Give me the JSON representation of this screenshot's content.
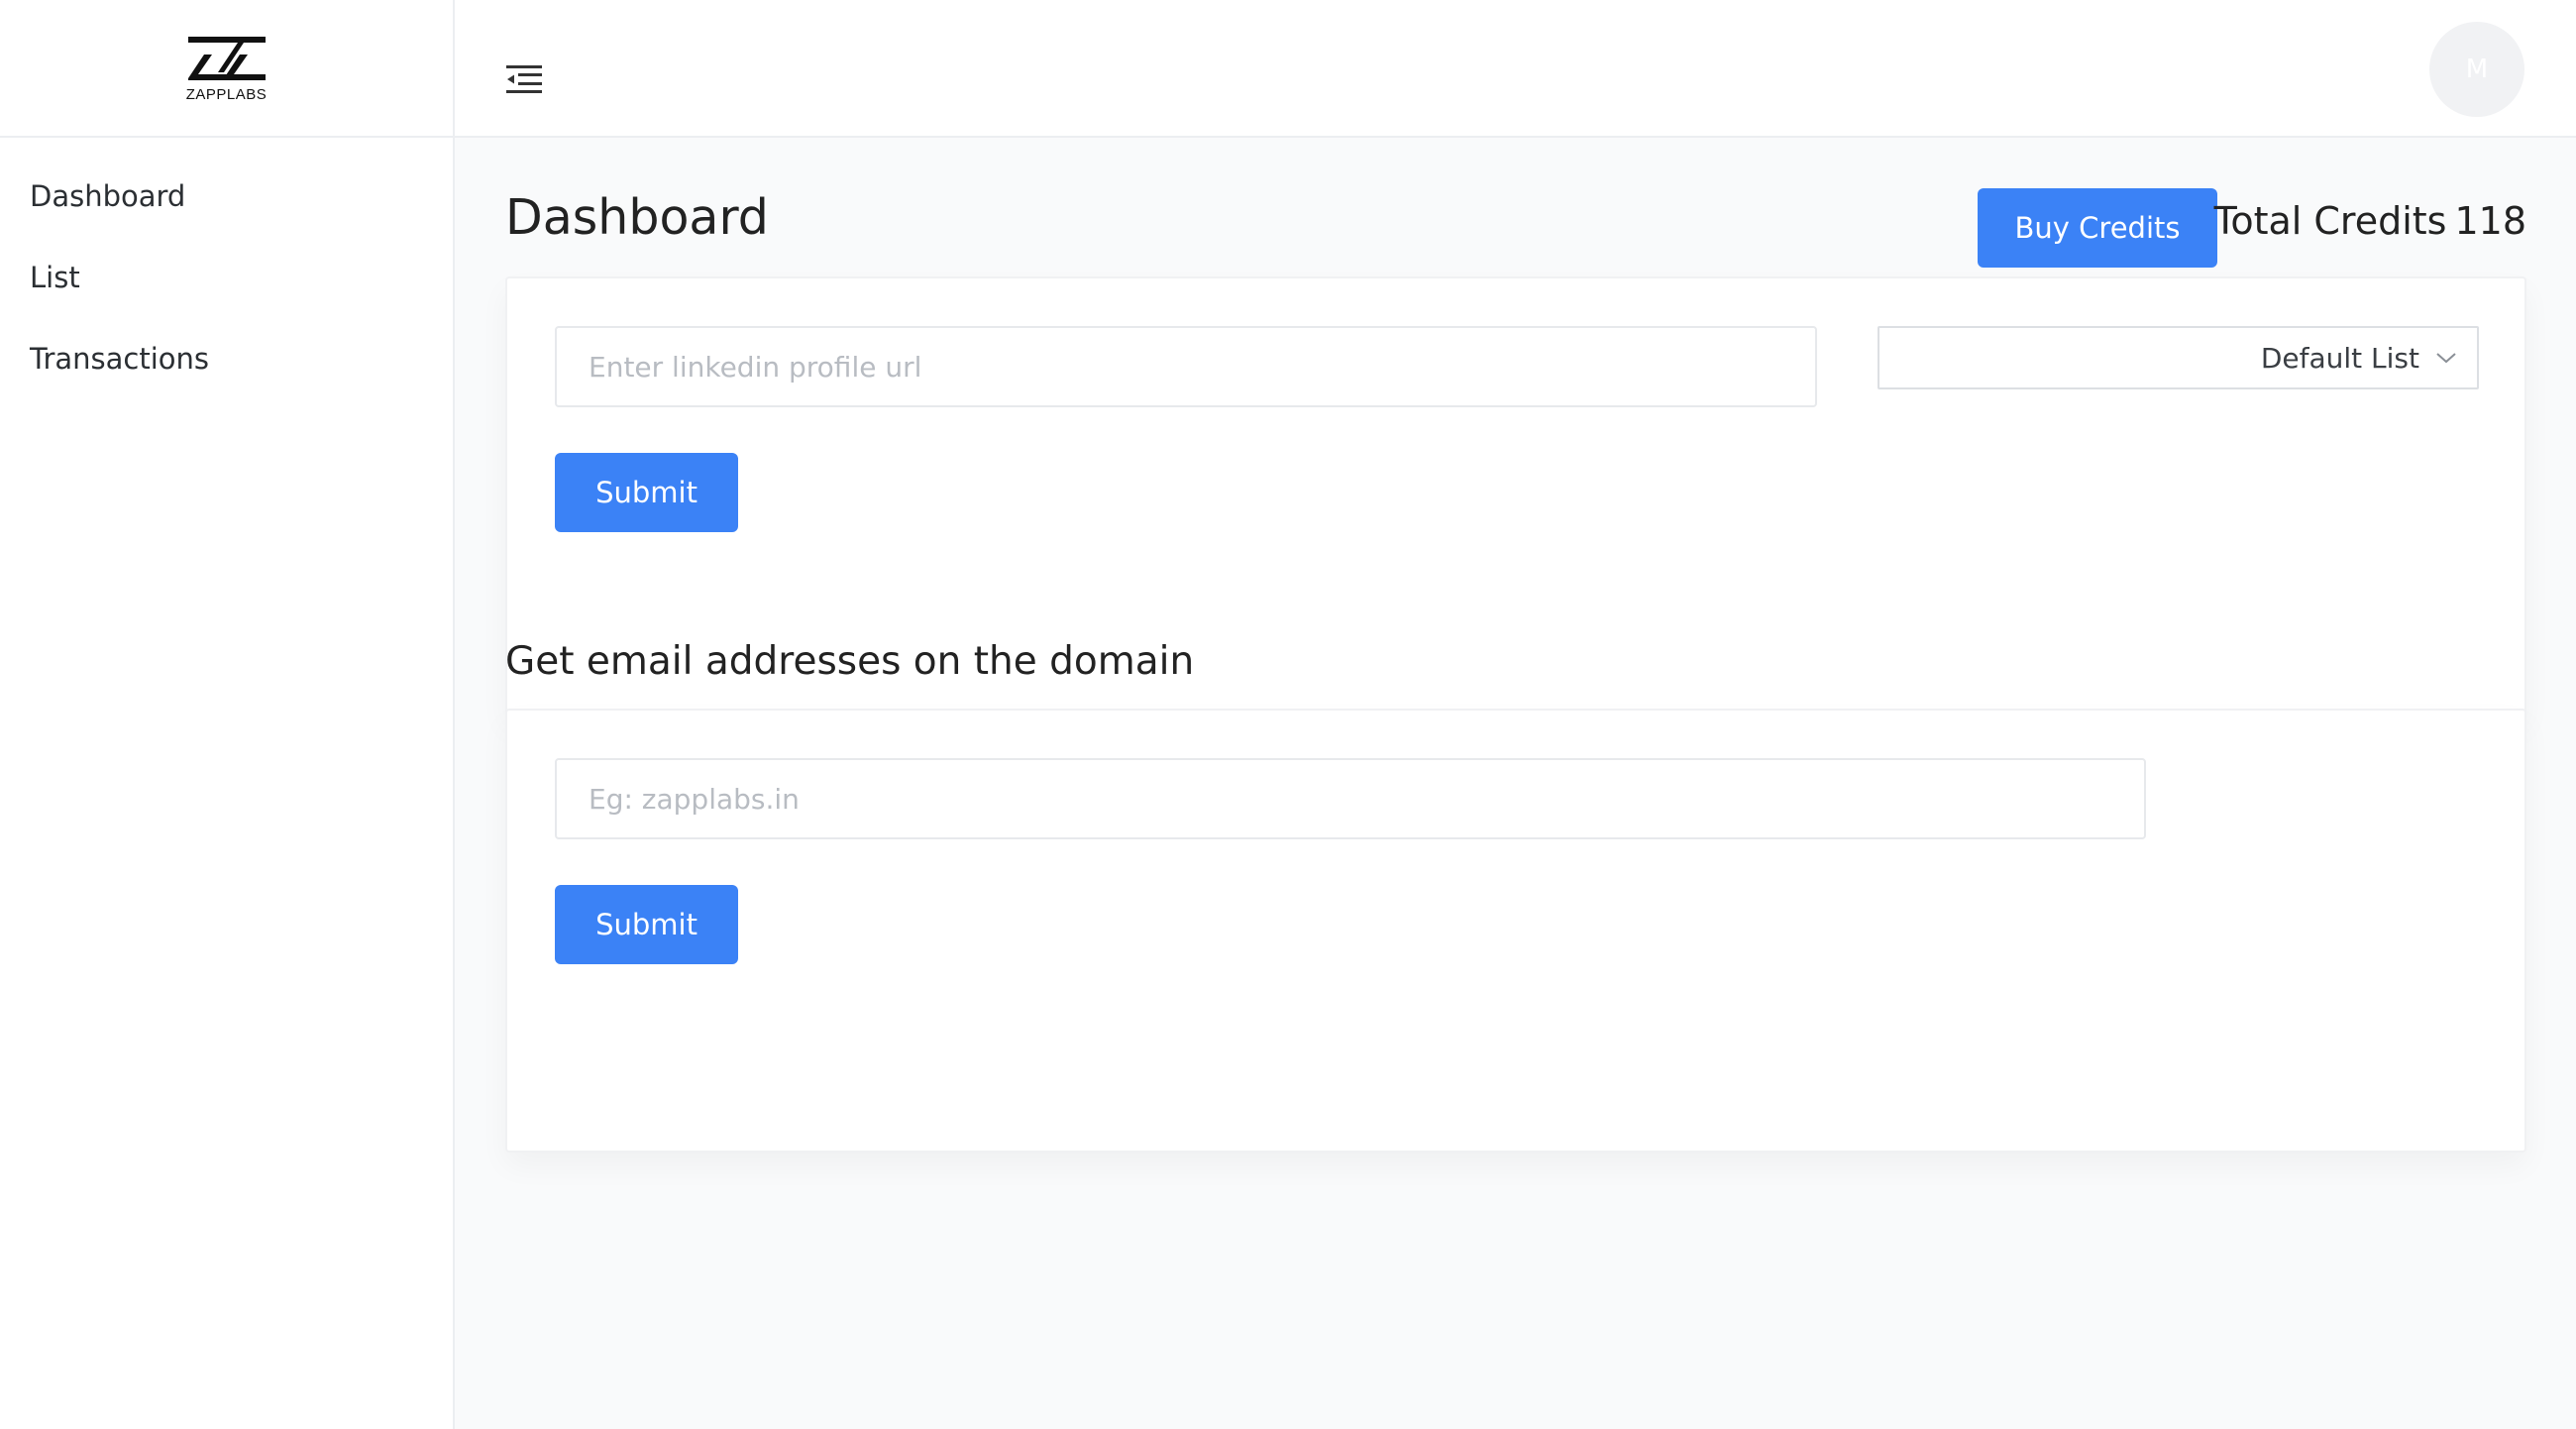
{
  "brand": {
    "name": "ZAPPLABS"
  },
  "sidebar": {
    "items": [
      {
        "label": "Dashboard"
      },
      {
        "label": "List"
      },
      {
        "label": "Transactions"
      }
    ]
  },
  "header": {
    "menu_icon": "menu-collapse-icon",
    "avatar_initial": "M"
  },
  "main": {
    "title": "Dashboard",
    "buy_credits_label": "Buy Credits",
    "credits_label": "Total Credits",
    "credits_value": "118",
    "linkedin": {
      "placeholder": "Enter linkedin profile url",
      "value": "",
      "list_select_value": "Default List",
      "submit_label": "Submit"
    },
    "domain_section": {
      "title": "Get email addresses on the domain",
      "placeholder": "Eg: zapplabs.in",
      "value": "",
      "submit_label": "Submit"
    }
  },
  "colors": {
    "accent": "#3b82f6",
    "background": "#f9fafb",
    "surface": "#ffffff"
  }
}
